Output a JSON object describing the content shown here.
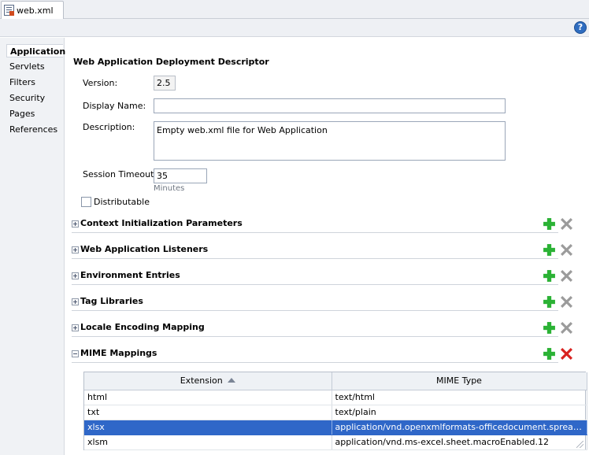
{
  "tab": {
    "title": "web.xml"
  },
  "help": {
    "label": "?"
  },
  "sidebar": {
    "items": [
      {
        "label": "Application"
      },
      {
        "label": "Servlets"
      },
      {
        "label": "Filters"
      },
      {
        "label": "Security"
      },
      {
        "label": "Pages"
      },
      {
        "label": "References"
      }
    ]
  },
  "main": {
    "title": "Web Application Deployment Descriptor",
    "version_label": "Version:",
    "version_value": "2.5",
    "display_name_label": "Display Name:",
    "display_name_value": "",
    "description_label": "Description:",
    "description_value": "Empty web.xml file for Web Application",
    "session_timeout_label": "Session Timeout:",
    "session_timeout_value": "35",
    "minutes_label": "Minutes",
    "distributable_label": "Distributable",
    "distributable_checked": false
  },
  "sections": [
    {
      "title": "Context Initialization Parameters",
      "expanded": false
    },
    {
      "title": "Web Application Listeners",
      "expanded": false
    },
    {
      "title": "Environment Entries",
      "expanded": false
    },
    {
      "title": "Tag Libraries",
      "expanded": false
    },
    {
      "title": "Locale Encoding Mapping",
      "expanded": false
    },
    {
      "title": "MIME Mappings",
      "expanded": true
    }
  ],
  "mime_table": {
    "columns": [
      "Extension",
      "MIME Type"
    ],
    "rows": [
      {
        "extension": "html",
        "mime": "text/html",
        "selected": false
      },
      {
        "extension": "txt",
        "mime": "text/plain",
        "selected": false
      },
      {
        "extension": "xlsx",
        "mime": "application/vnd.openxmlformats-officedocument.spreadsheetml.sheet",
        "selected": true
      },
      {
        "extension": "xlsm",
        "mime": "application/vnd.ms-excel.sheet.macroEnabled.12",
        "selected": false
      }
    ]
  },
  "icons": {
    "tab": "xml-file-icon",
    "help": "help-icon",
    "add": "plus-icon",
    "remove": "close-icon",
    "sort": "sort-ascending-icon"
  },
  "colors": {
    "selection": "#2f67c8",
    "add_green": "#2bb235",
    "remove_red": "#d9221f",
    "remove_gray": "#9b9b9b"
  }
}
